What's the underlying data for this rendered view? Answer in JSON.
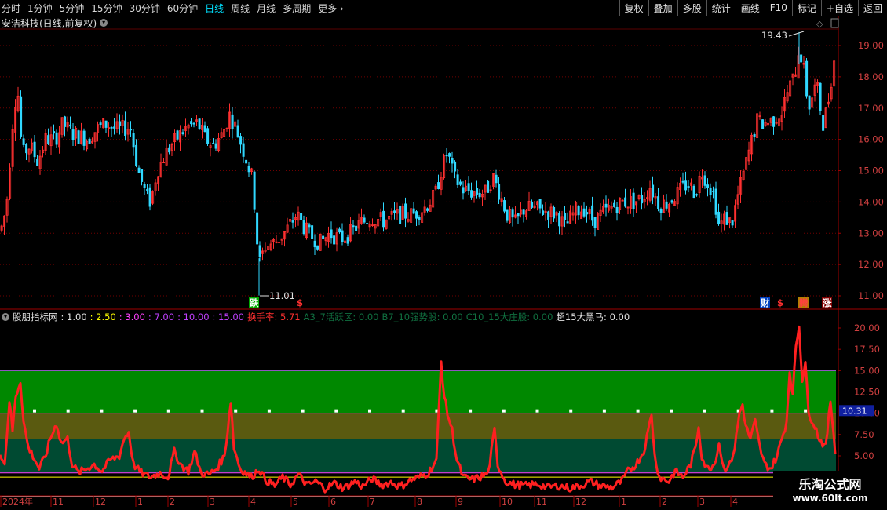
{
  "toolbar": {
    "periods": [
      "分时",
      "1分钟",
      "5分钟",
      "15分钟",
      "30分钟",
      "60分钟",
      "日线",
      "周线",
      "月线",
      "多周期",
      "更多"
    ],
    "active": "日线",
    "buttons": [
      "复权",
      "叠加",
      "多股",
      "统计",
      "画线",
      "F10",
      "标记",
      "+自选",
      "返回"
    ]
  },
  "stock": {
    "title": "安洁科技(日线,前复权)"
  },
  "price_chart": {
    "y_ticks": [
      "19.00",
      "18.00",
      "17.00",
      "16.00",
      "15.00",
      "14.00",
      "13.00",
      "12.00",
      "11.00"
    ],
    "y_values": [
      19,
      18,
      17,
      16,
      15,
      14,
      13,
      12,
      11
    ],
    "high_label": "19.43",
    "low_label": "11.01",
    "markers": {
      "fall": "跌",
      "dollar": "$",
      "cai": "财",
      "dollar2": "$",
      "teng": "腾",
      "zhang": "涨"
    }
  },
  "indicator": {
    "name": "股朋指标网",
    "params": [
      {
        "label": ": 1.00",
        "color": "#e0e0e0"
      },
      {
        "label": ": 2.50",
        "color": "#ffff00"
      },
      {
        "label": ": 3.00",
        "color": "#ff40ff"
      },
      {
        "label": ": 7.00",
        "color": "#c040ff"
      },
      {
        "label": ": 10.00",
        "color": "#c040ff"
      },
      {
        "label": ": 15.00",
        "color": "#c040ff"
      },
      {
        "label": "换手率: 5.71",
        "color": "#ff3030"
      },
      {
        "label": "A3_7活跃区: 0.00",
        "color": "#107040"
      },
      {
        "label": "B7_10强势股: 0.00",
        "color": "#107040"
      },
      {
        "label": "C10_15大庄股: 0.00",
        "color": "#107040"
      },
      {
        "label": "超15大黑马: 0.00",
        "color": "#e0e0e0"
      }
    ],
    "y_ticks": [
      "20.00",
      "17.50",
      "15.00",
      "12.50",
      "10.00",
      "7.50",
      "5.00"
    ],
    "y_values": [
      20,
      17.5,
      15,
      12.5,
      10,
      7.5,
      5
    ],
    "current_value": "10.31"
  },
  "x_axis": {
    "labels": [
      "2024年",
      "11",
      "12",
      "1",
      "2",
      "3",
      "4",
      "5",
      "6",
      "7",
      "8",
      "9",
      "10",
      "11",
      "12",
      "1",
      "2",
      "3",
      "4"
    ]
  },
  "watermark": {
    "line1": "乐淘公式网",
    "line2": "www.60lt.com"
  },
  "colors": {
    "up": "#ff3030",
    "down": "#30d8ff",
    "band_green": "#008800",
    "band_olive": "#5a5a10",
    "band_teal": "#004a32"
  }
}
